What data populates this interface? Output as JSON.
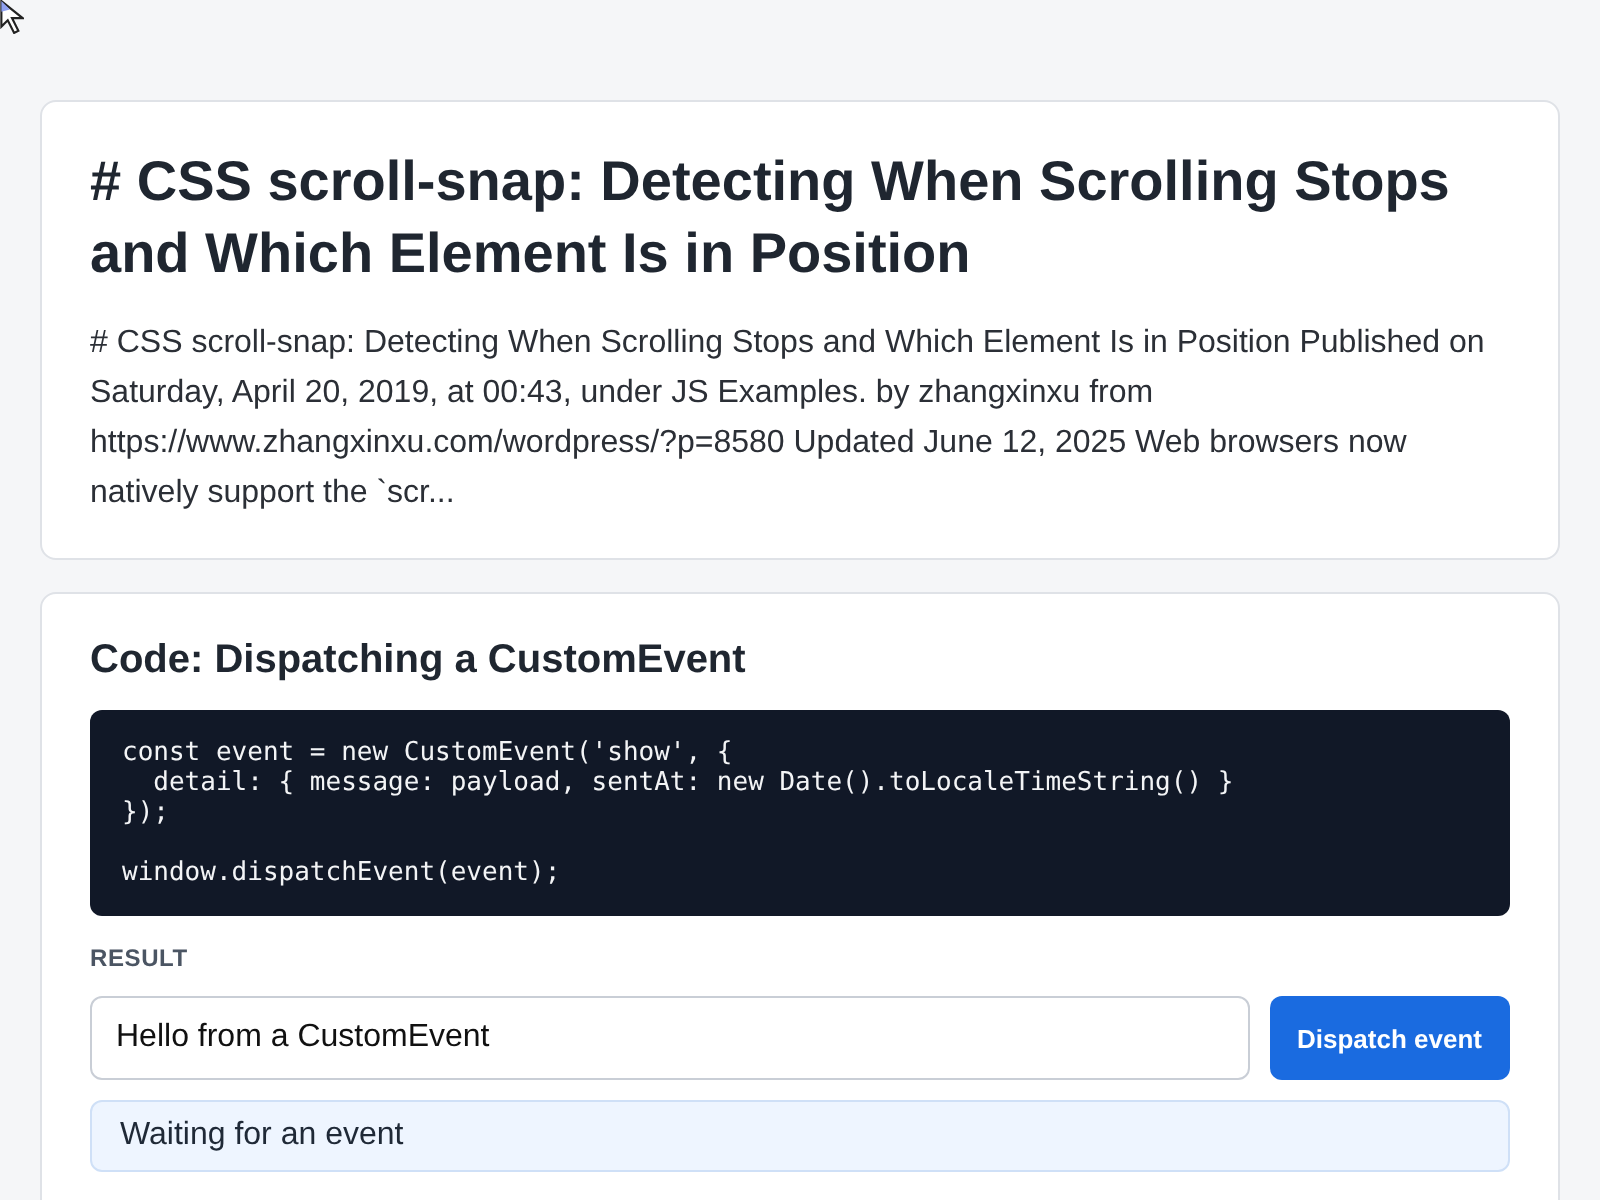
{
  "article": {
    "title": "# CSS scroll-snap: Detecting When Scrolling Stops and Which Element Is in Position",
    "excerpt": "# CSS scroll-snap: Detecting When Scrolling Stops and Which Element Is in Position Published on Saturday, April 20, 2019, at 00:43, under JS Examples. by zhangxinxu from https://www.zhangxinxu.com/wordpress/?p=8580 Updated June 12, 2025 Web browsers now natively support the `scr..."
  },
  "demo": {
    "title": "Code: Dispatching a CustomEvent",
    "code": "const event = new CustomEvent('show', {\n  detail: { message: payload, sentAt: new Date().toLocaleTimeString() }\n});\n\nwindow.dispatchEvent(event);",
    "result_label": "RESULT",
    "input_value": "Hello from a CustomEvent",
    "button": "Dispatch event",
    "output": "Waiting for an event"
  }
}
